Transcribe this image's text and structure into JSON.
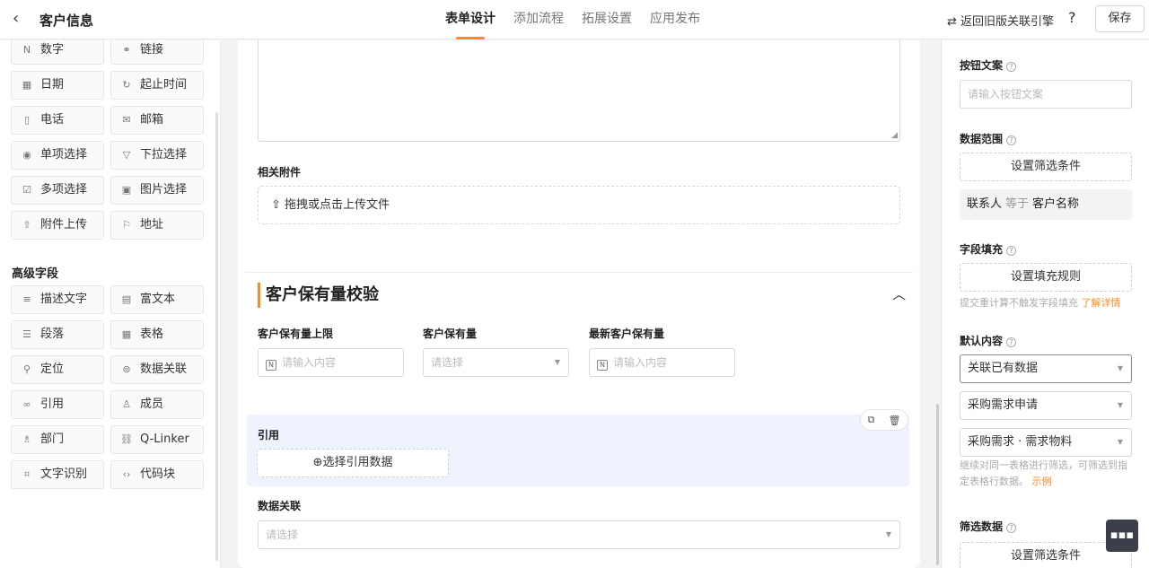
{
  "header": {
    "back_icon": "‹",
    "title": "客户信息",
    "tabs": [
      {
        "label": "表单设计",
        "active": true
      },
      {
        "label": "添加流程",
        "active": false
      },
      {
        "label": "拓展设置",
        "active": false
      },
      {
        "label": "应用发布",
        "active": false
      }
    ],
    "legacy_link": "⇄ 返回旧版关联引擎",
    "help_icon": "?",
    "save_label": "保存"
  },
  "palette": {
    "basic_items": [
      {
        "label": "数字",
        "icon": "N"
      },
      {
        "label": "链接",
        "icon": "⚭"
      },
      {
        "label": "日期",
        "icon": "▦"
      },
      {
        "label": "起止时间",
        "icon": "↻"
      },
      {
        "label": "电话",
        "icon": "▯"
      },
      {
        "label": "邮箱",
        "icon": "✉"
      },
      {
        "label": "单项选择",
        "icon": "◉"
      },
      {
        "label": "下拉选择",
        "icon": "▽"
      },
      {
        "label": "多项选择",
        "icon": "☑"
      },
      {
        "label": "图片选择",
        "icon": "▣"
      },
      {
        "label": "附件上传",
        "icon": "⇧"
      },
      {
        "label": "地址",
        "icon": "⚐"
      }
    ],
    "advanced_title": "高级字段",
    "advanced_items": [
      {
        "label": "描述文字",
        "icon": "≡"
      },
      {
        "label": "富文本",
        "icon": "▤"
      },
      {
        "label": "段落",
        "icon": "☰"
      },
      {
        "label": "表格",
        "icon": "▦"
      },
      {
        "label": "定位",
        "icon": "⚲"
      },
      {
        "label": "数据关联",
        "icon": "⊚"
      },
      {
        "label": "引用",
        "icon": "∞"
      },
      {
        "label": "成员",
        "icon": "♙"
      },
      {
        "label": "部门",
        "icon": "♗"
      },
      {
        "label": "Q-Linker",
        "icon": "⛓"
      },
      {
        "label": "文字识别",
        "icon": "⌗"
      },
      {
        "label": "代码块",
        "icon": "‹›"
      }
    ]
  },
  "form": {
    "attachment_label": "相关附件",
    "upload_text": "⇧ 拖拽或点击上传文件",
    "section_title": "客户保有量校验",
    "collapse_icon": "︿",
    "fields": [
      {
        "label": "客户保有量上限",
        "placeholder": "请输入内容"
      },
      {
        "label": "客户保有量",
        "placeholder": "请选择"
      },
      {
        "label": "最新客户保有量",
        "placeholder": "请输入内容"
      }
    ],
    "reference": {
      "label": "引用",
      "button": "⊕选择引用数据",
      "copy_icon": "⧉",
      "delete_icon": "🗑"
    },
    "data_link": {
      "label": "数据关联",
      "placeholder": "请选择"
    }
  },
  "props": {
    "button_text": {
      "label": "按钮文案",
      "placeholder": "请输入按钮文案"
    },
    "data_range": {
      "label": "数据范围",
      "button": "设置筛选条件",
      "condition": {
        "field": "联系人",
        "op": "等于",
        "value": "客户名称"
      }
    },
    "field_fill": {
      "label": "字段填充",
      "button": "设置填充规则",
      "hint": "提交重计算不触发字段填充",
      "hint_link": "了解详情"
    },
    "default_content": {
      "label": "默认内容",
      "select1": "关联已有数据",
      "select2": "采购需求申请",
      "select3": "采购需求 · 需求物料",
      "hint": "继续对同一表格进行筛选，可筛选到指定表格行数据。",
      "hint_link": "示例"
    },
    "filter_data": {
      "label": "筛选数据",
      "button": "设置筛选条件"
    }
  },
  "chat_icon": "▪▪▪"
}
